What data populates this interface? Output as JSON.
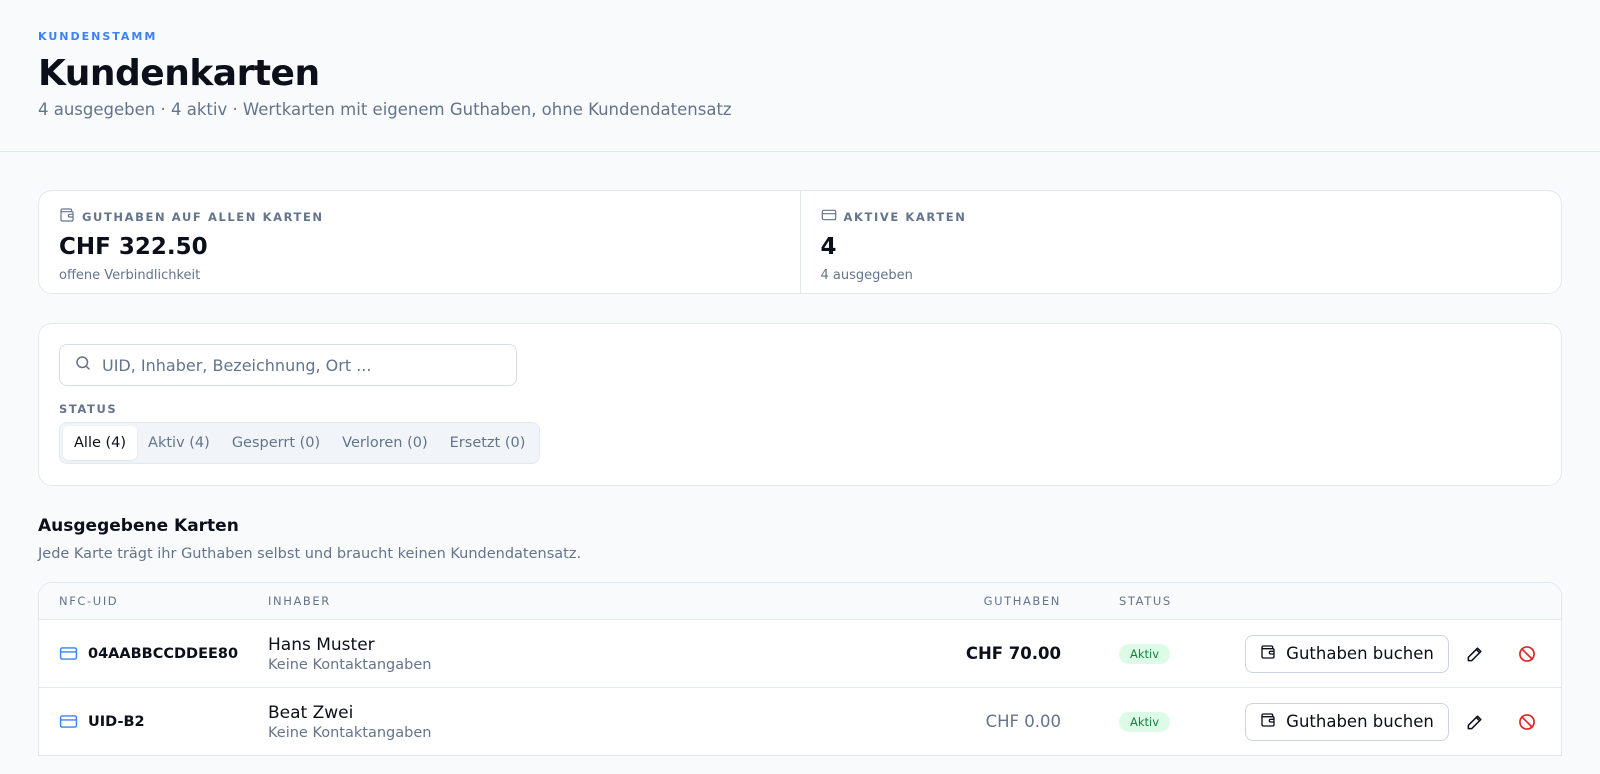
{
  "header": {
    "eyebrow": "KUNDENSTAMM",
    "title": "Kundenkarten",
    "subtitle": "4 ausgegeben · 4 aktiv · Wertkarten mit eigenem Guthaben, ohne Kundendatensatz"
  },
  "stats": [
    {
      "label": "GUTHABEN AUF ALLEN KARTEN",
      "value": "CHF 322.50",
      "sub": "offene Verbindlichkeit",
      "icon": "wallet-icon"
    },
    {
      "label": "AKTIVE KARTEN",
      "value": "4",
      "sub": "4 ausgegeben",
      "icon": "credit-card-icon"
    }
  ],
  "filters": {
    "search_placeholder": "UID, Inhaber, Bezeichnung, Ort ...",
    "status_label": "STATUS",
    "status_options": [
      "Alle (4)",
      "Aktiv (4)",
      "Gesperrt (0)",
      "Verloren (0)",
      "Ersetzt (0)"
    ],
    "status_selected": "Alle (4)"
  },
  "section": {
    "title": "Ausgegebene Karten",
    "subtitle": "Jede Karte trägt ihr Guthaben selbst und braucht keinen Kundendatensatz."
  },
  "table": {
    "columns": [
      "NFC-UID",
      "INHABER",
      "GUTHABEN",
      "STATUS"
    ],
    "rows": [
      {
        "uid": "04AABBCCDDEE80",
        "owner": "Hans Muster",
        "contact": "Keine Kontaktangaben",
        "balance": "CHF 70.00",
        "status": "Aktiv",
        "action": "Guthaben buchen"
      },
      {
        "uid": "UID-B2",
        "owner": "Beat Zwei",
        "contact": "Keine Kontaktangaben",
        "balance": "CHF 0.00",
        "status": "Aktiv",
        "action": "Guthaben buchen"
      }
    ]
  },
  "colors": {
    "accent": "#3b82f6",
    "success_bg": "#dcfce7",
    "success_text": "#15803d",
    "danger": "#dc2626"
  }
}
